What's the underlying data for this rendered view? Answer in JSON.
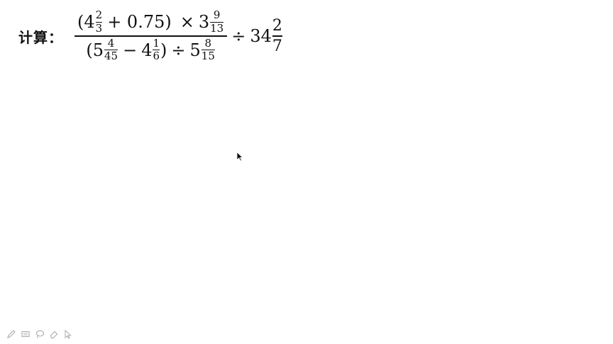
{
  "problem": {
    "prompt": "计算：",
    "numerator": {
      "open": "(4",
      "f1": {
        "n": "2",
        "d": "3"
      },
      "plus": "+ 0.75)",
      "times": "×",
      "three": "3",
      "f2": {
        "n": "9",
        "d": "13"
      }
    },
    "denominator": {
      "open": "(5",
      "f1": {
        "n": "4",
        "d": "45"
      },
      "minus": "−",
      "four": "4",
      "f2": {
        "n": "1",
        "d": "6"
      },
      "close": ")",
      "div": "÷",
      "five": "5",
      "f3": {
        "n": "8",
        "d": "15"
      }
    },
    "div": "÷",
    "whole": "34",
    "tail": {
      "n": "2",
      "d": "7"
    }
  },
  "toolbar": {
    "tools": [
      "pen-icon",
      "rectangle-icon",
      "lasso-icon",
      "eraser-icon",
      "pointer-icon"
    ]
  },
  "colors": {
    "ink": "#111111",
    "toolbar": "#b0b0b0"
  }
}
